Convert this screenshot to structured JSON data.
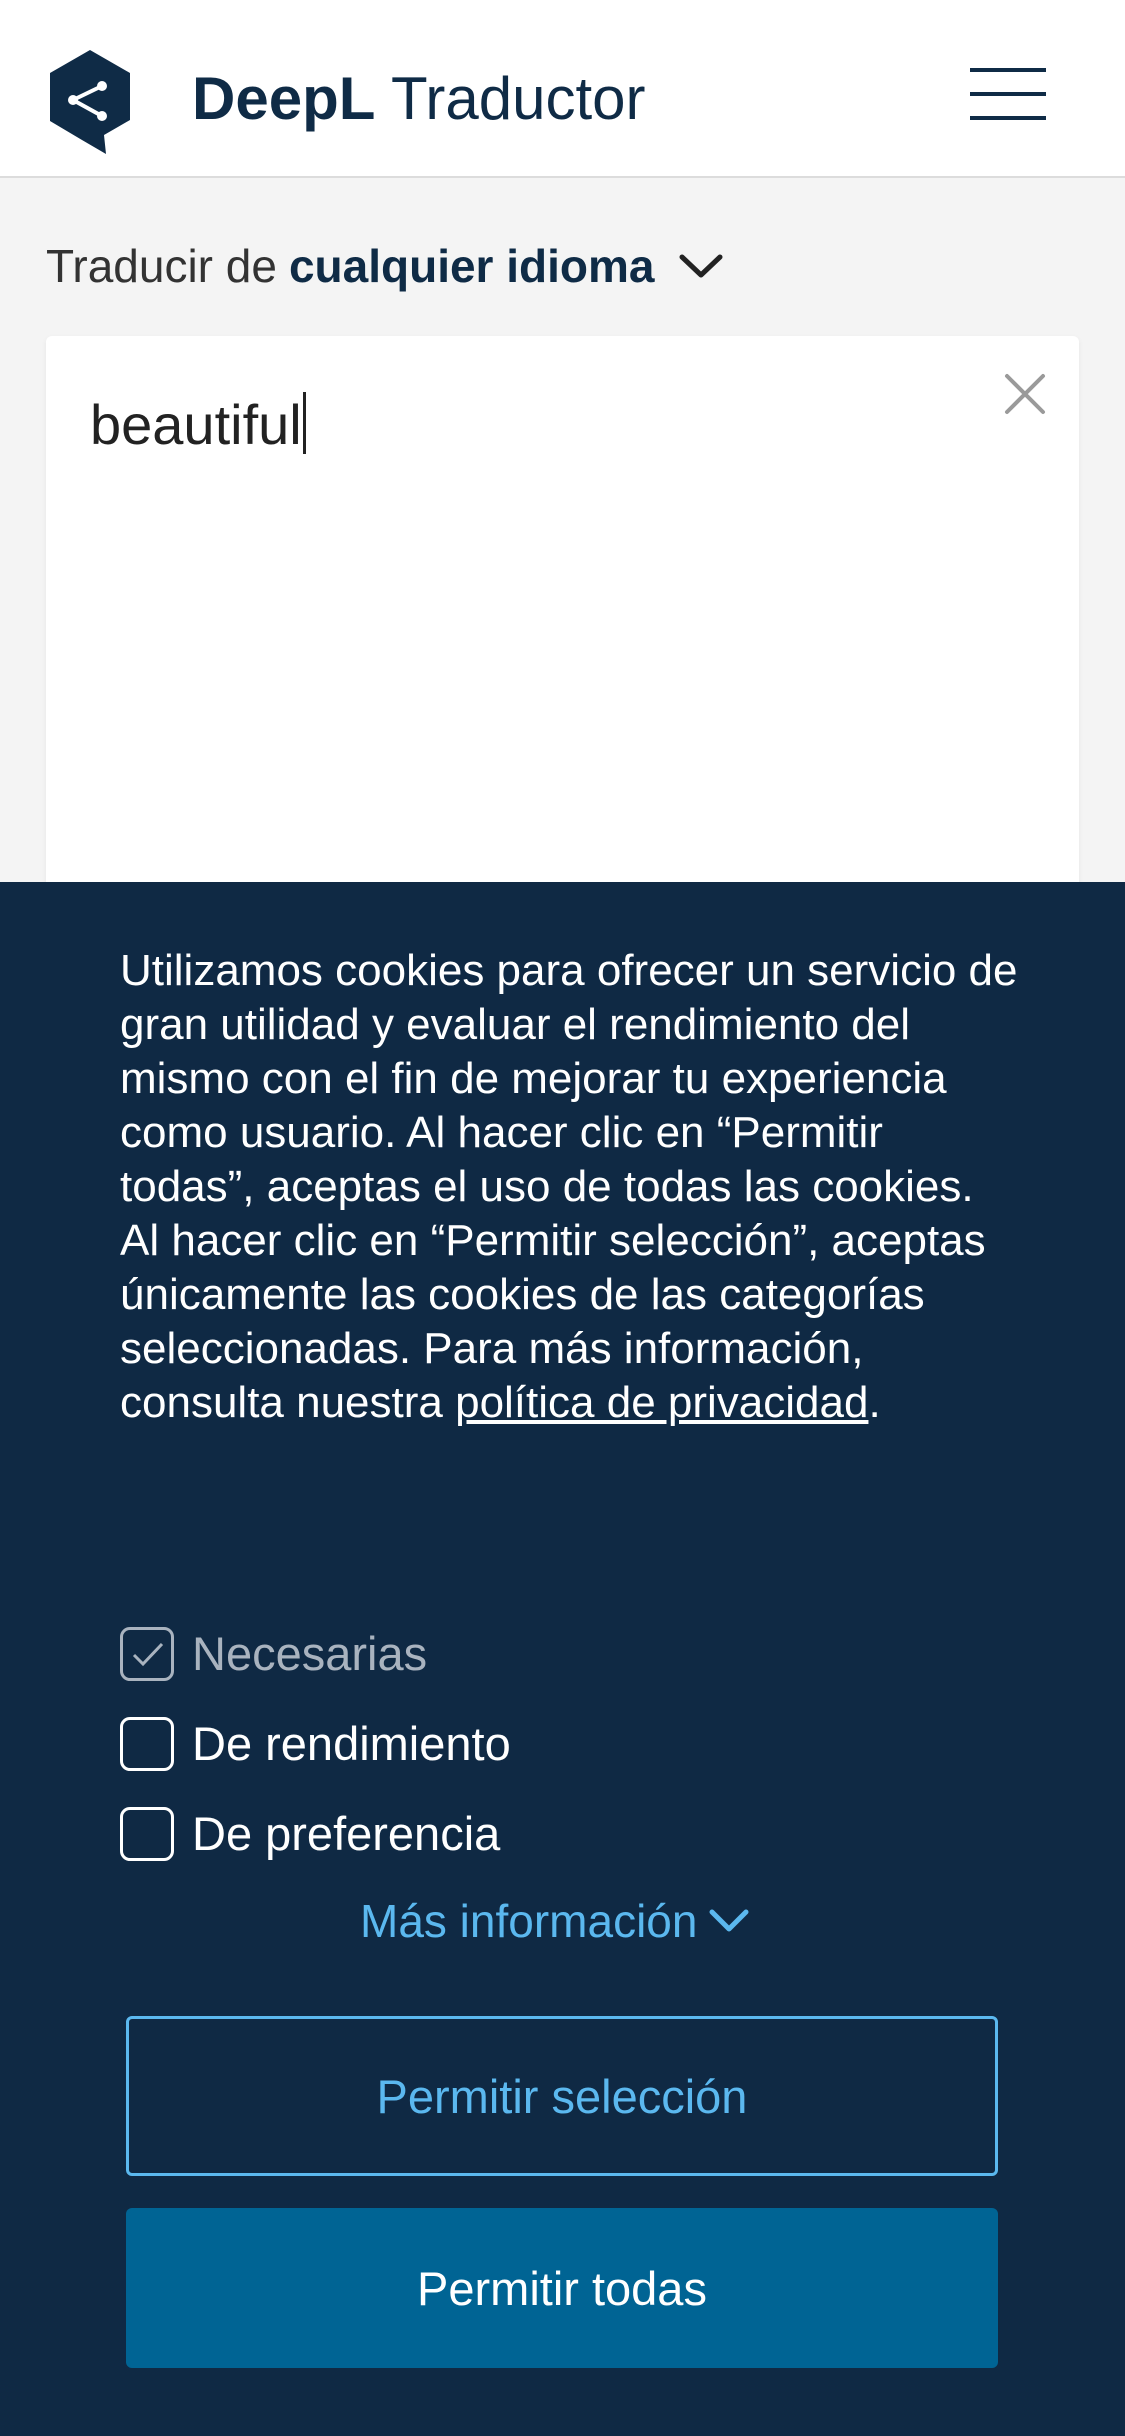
{
  "header": {
    "brand_bold": "DeepL",
    "brand_regular": "Traductor",
    "logo_icon": "deepl-logo",
    "menu_icon": "hamburger-menu-icon"
  },
  "translator": {
    "source_prefix": "Traducir de",
    "source_language": "cualquier idioma",
    "input_text": "beautiful",
    "clear_icon": "close-icon"
  },
  "cookie_banner": {
    "text": "Utilizamos cookies para ofrecer un servicio de gran utilidad y evaluar el rendimiento del mismo con el fin de mejorar tu experiencia como usuario. Al hacer clic en “Permitir todas”, aceptas el uso de todas las cookies. Al hacer clic en “Permitir selección”, aceptas únicamente las cookies de las categorías seleccionadas. Para más información, consulta nuestra ",
    "privacy_link": "política de privacidad",
    "text_end": ".",
    "options": [
      {
        "label": "Necesarias",
        "checked": true,
        "disabled": true
      },
      {
        "label": "De rendimiento",
        "checked": false,
        "disabled": false
      },
      {
        "label": "De preferencia",
        "checked": false,
        "disabled": false
      }
    ],
    "more_info": "Más información",
    "allow_selection": "Permitir selección",
    "allow_all": "Permitir todas"
  },
  "colors": {
    "banner_bg": "#0f2944",
    "accent_blue": "#5bb8ef",
    "primary_button": "#006494",
    "brand_navy": "#0f2b46"
  }
}
